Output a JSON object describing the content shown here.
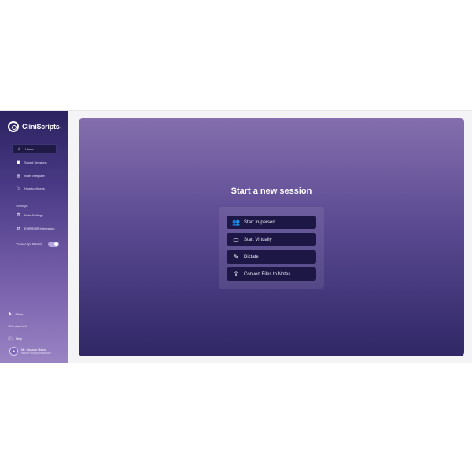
{
  "brand": {
    "name": "CliniScripts"
  },
  "sidebar": {
    "items": [
      {
        "label": "Home",
        "icon": "home-icon"
      },
      {
        "label": "Saved Sessions",
        "icon": "folder-icon"
      },
      {
        "label": "Note Template",
        "icon": "document-icon"
      },
      {
        "label": "How to Videos",
        "icon": "play-icon"
      }
    ],
    "settings_label": "Settings",
    "settings_items": [
      {
        "label": "Note Settings",
        "icon": "gear-icon"
      },
      {
        "label": "EHR/EMR Integration",
        "icon": "integration-icon"
      }
    ],
    "toggle_label": "Transcript Panel",
    "silver_label": "Silver",
    "notes_left": "117 notes left",
    "help_label": "Help",
    "user_name": "Mr. Hassan Reza",
    "user_email": "hassan.reza@hotmail.com"
  },
  "main": {
    "title": "Start a new session",
    "actions": [
      {
        "label": "Start In-person",
        "icon": "people-icon"
      },
      {
        "label": "Start Virtually",
        "icon": "monitor-icon"
      },
      {
        "label": "Dictate",
        "icon": "edit-note-icon"
      },
      {
        "label": "Convert Files to Notes",
        "icon": "upload-icon"
      }
    ]
  },
  "colors": {
    "sidebar_top": "#2b2260",
    "sidebar_bottom": "#9a84c4",
    "panel_top": "#846ead",
    "panel_bottom": "#2f2766",
    "button_bg": "#1c1744"
  }
}
